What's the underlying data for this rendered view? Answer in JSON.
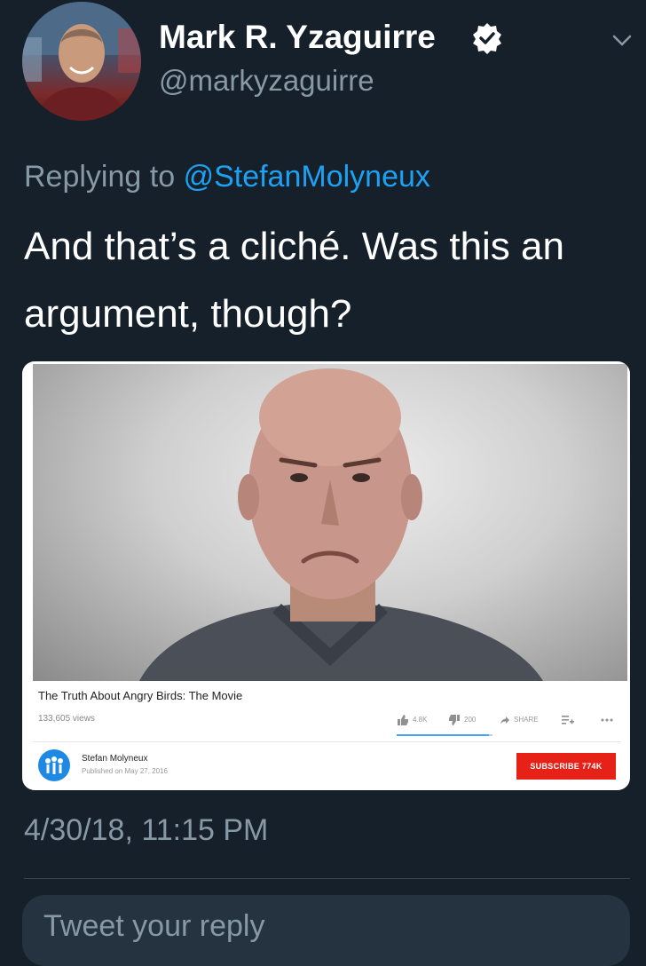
{
  "author": {
    "display_name": "Mark R. Yzaguirre",
    "handle": "@markyzaguirre",
    "verified": true
  },
  "reply_context": {
    "prefix": "Replying to",
    "mention": "@StefanMolyneux"
  },
  "tweet": {
    "text": "And that’s a cliché. Was this an argument, though?",
    "timestamp": "4/30/18, 11:15 PM"
  },
  "media": {
    "video_title": "The Truth About Angry Birds: The Movie",
    "views": "133,605 views",
    "likes": "4.8K",
    "dislikes": "200",
    "share_label": "SHARE",
    "like_ratio": 0.96,
    "channel_name": "Stefan Molyneux",
    "published": "Published on May 27, 2016",
    "subscribe_label": "SUBSCRIBE",
    "subscriber_count": "774K"
  },
  "reply_box": {
    "placeholder": "Tweet your reply"
  },
  "colors": {
    "background": "#15202b",
    "accent": "#1da1f2",
    "secondary_text": "#8899a6",
    "subscribe_red": "#e62117"
  },
  "icons": {
    "verified": "verified-badge-icon",
    "menu": "chevron-down-icon",
    "like": "thumbs-up-icon",
    "dislike": "thumbs-down-icon",
    "share": "share-arrow-icon",
    "add_to_playlist": "playlist-add-icon",
    "more": "more-dots-icon"
  }
}
